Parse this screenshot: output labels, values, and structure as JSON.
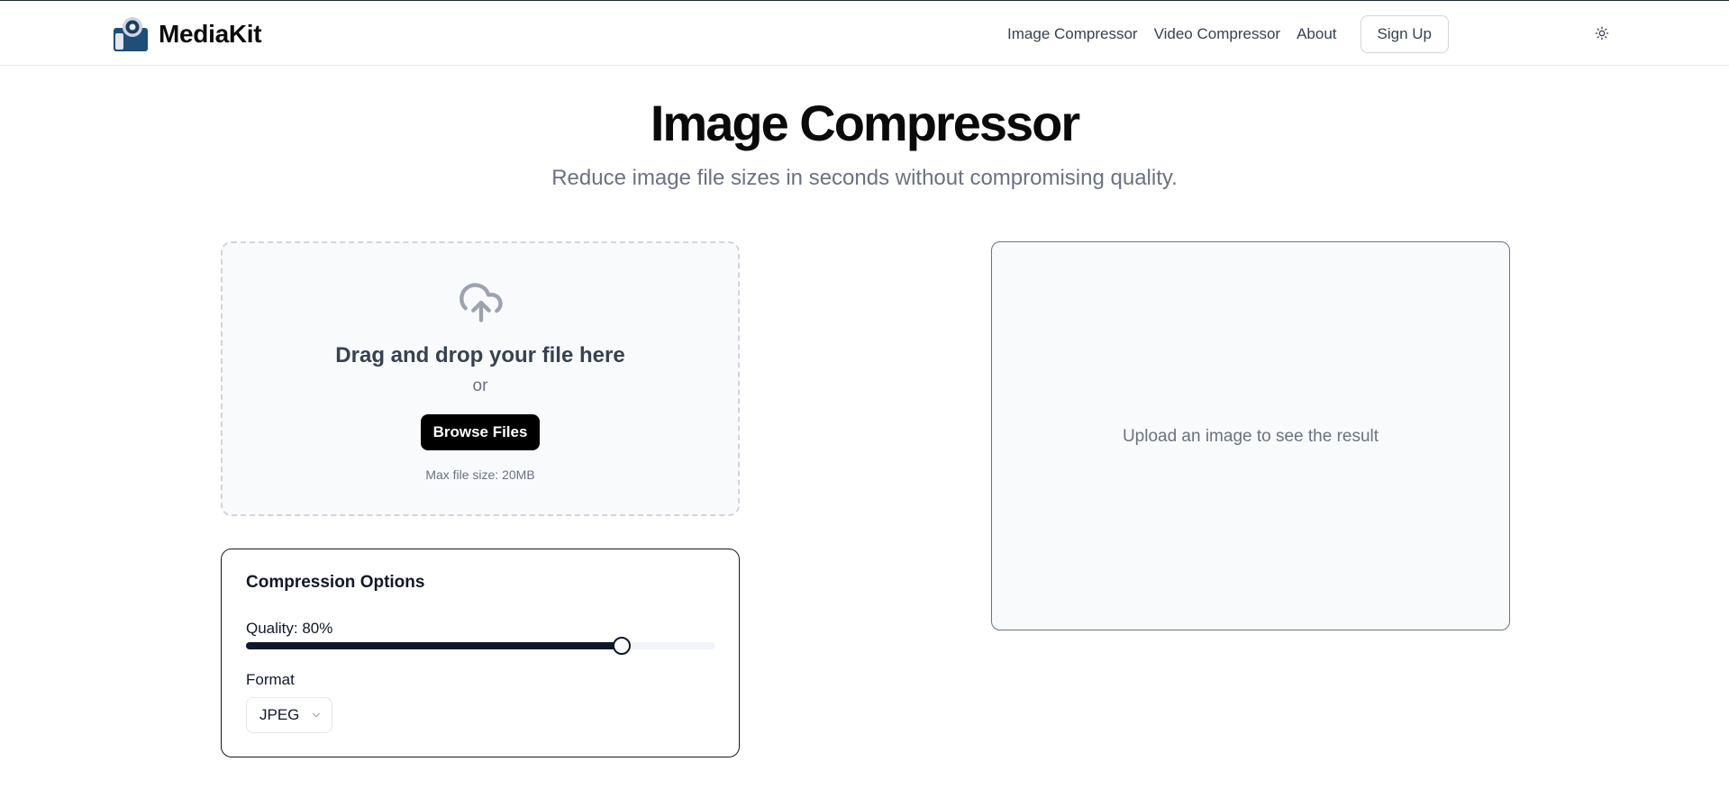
{
  "brand": {
    "name": "MediaKit",
    "logo_icon": "camera-logo-icon"
  },
  "nav": {
    "links": [
      "Image Compressor",
      "Video Compressor",
      "About"
    ],
    "signup_label": "Sign Up",
    "theme_icon": "sun-icon"
  },
  "hero": {
    "title": "Image Compressor",
    "subtitle": "Reduce image file sizes in seconds without compromising quality."
  },
  "dropzone": {
    "icon": "cloud-upload-icon",
    "title": "Drag and drop your file here",
    "or_text": "or",
    "browse_label": "Browse Files",
    "max_size_text": "Max file size: 20MB"
  },
  "options": {
    "title": "Compression Options",
    "quality_label": "Quality: 80%",
    "quality_value": 0.8,
    "format_label": "Format",
    "format_value": "JPEG"
  },
  "result": {
    "placeholder": "Upload an image to see the result"
  },
  "colors": {
    "accent": "#000000",
    "slider_fill": "#0f172a",
    "muted_text": "#6b7280",
    "panel_bg": "#f9fafb"
  }
}
